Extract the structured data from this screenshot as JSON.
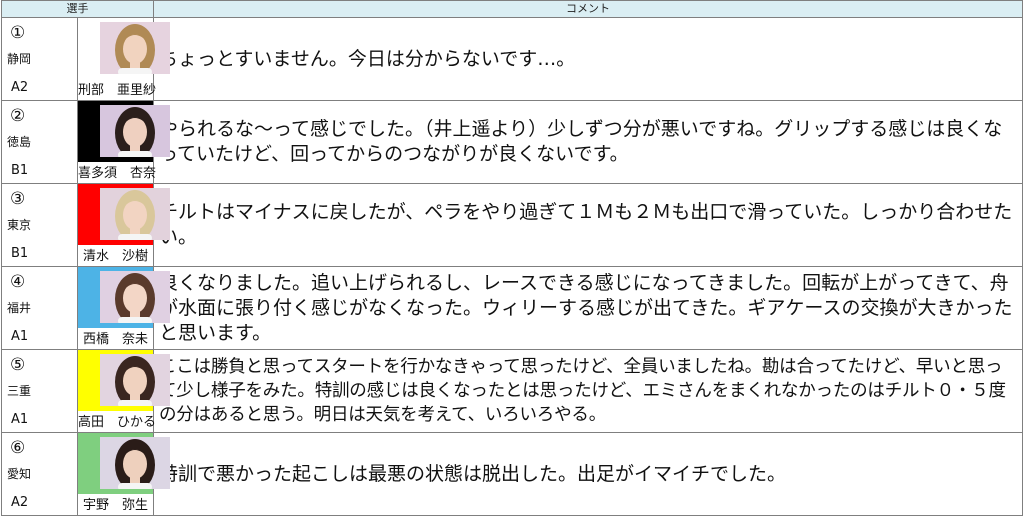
{
  "header": {
    "player_col": "選手",
    "comment_col": "コメント"
  },
  "rows": [
    {
      "num": "①",
      "pref": "静岡",
      "cls": "A2",
      "name": "刑部　亜里紗",
      "band_color": "#ffffff",
      "face_bg": "#e6d3df",
      "hair": "#b08a55",
      "skin": "#f1d3bf",
      "comment": "ちょっとすいません。今日は分からないです…。"
    },
    {
      "num": "②",
      "pref": "徳島",
      "cls": "B1",
      "name": "喜多須　杏奈",
      "band_color": "#000000",
      "face_bg": "#d7c6de",
      "hair": "#2b1f1c",
      "skin": "#efd0c0",
      "comment": "やられるな～って感じでした。（井上遥より）少しずつ分が悪いですね。グリップする感じは良くなっていたけど、回ってからのつながりが良くないです。"
    },
    {
      "num": "③",
      "pref": "東京",
      "cls": "B1",
      "name": "清水　沙樹",
      "band_color": "#ff0000",
      "face_bg": "#e2d2dc",
      "hair": "#d9c79b",
      "skin": "#f2d4c2",
      "comment": "チルトはマイナスに戻したが、ペラをやり過ぎて１Ｍも２Ｍも出口で滑っていた。しっかり合わせたい。"
    },
    {
      "num": "④",
      "pref": "福井",
      "cls": "A1",
      "name": "西橋　奈未",
      "band_color": "#4db3e6",
      "face_bg": "#e0d0e2",
      "hair": "#5a3a2c",
      "skin": "#f3d6c6",
      "comment": "良くなりました。追い上げられるし、レースできる感じになってきました。回転が上がってきて、舟が水面に張り付く感じがなくなった。ウィリーする感じが出てきた。ギアケースの交換が大きかったと思います。"
    },
    {
      "num": "⑤",
      "pref": "三重",
      "cls": "A1",
      "name": "高田　ひかる",
      "band_color": "#ffff00",
      "face_bg": "#e2d4e0",
      "hair": "#3a2620",
      "skin": "#f0d2bf",
      "comment": "ここは勝負と思ってスタートを行かなきゃって思ったけど、全員いましたね。勘は合ってたけど、早いと思って少し様子をみた。特訓の感じは良くなったとは思ったけど、エミさんをまくれなかったのはチルト０・５度の分はあると思う。明日は天気を考えて、いろいろやる。"
    },
    {
      "num": "⑥",
      "pref": "愛知",
      "cls": "A2",
      "name": "宇野　弥生",
      "band_color": "#7fcf7f",
      "face_bg": "#dcd6e4",
      "hair": "#2a1c18",
      "skin": "#eed0bd",
      "comment": "特訓で悪かった起こしは最悪の状態は脱出した。出足がイマイチでした。"
    }
  ]
}
